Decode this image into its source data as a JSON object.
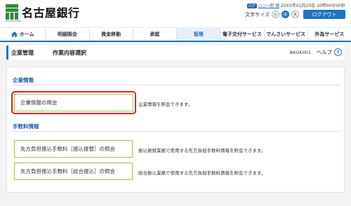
{
  "header": {
    "brand": "名古屋銀行",
    "brand_sub": "NAGOYA BANK",
    "user_badge": "ログ",
    "user_name": "○○一郎 様",
    "login_time": " 20XX年01月20日 10時00分00秒",
    "font_size_label": "文字サイズ",
    "font_sizes": [
      "小",
      "中",
      "大"
    ],
    "logout_label": "ログアウト"
  },
  "nav": {
    "items": [
      {
        "label": "ホーム"
      },
      {
        "label": "明細照会"
      },
      {
        "label": "資金移動"
      },
      {
        "label": "承認"
      },
      {
        "label": "管理"
      },
      {
        "label": "電子交付サービス"
      },
      {
        "label": "でんさいサービス"
      },
      {
        "label": "外為サービス"
      }
    ]
  },
  "titlebar": {
    "title": "企業管理",
    "subtitle": "作業内容選択",
    "screen_id": "BKGK001",
    "help_label": "ヘルプ"
  },
  "sections": [
    {
      "heading": "企業情報",
      "items": [
        {
          "label": "企業情報の照会",
          "description": "企業情報を照会できます。"
        }
      ]
    },
    {
      "heading": "手数料情報",
      "items": [
        {
          "label": "先方負担振込手数料［振込振替］の照会",
          "description": "振込振替業務で使用する先方負担手数料情報を照会できます。"
        },
        {
          "label": "先方負担振込手数料［総合振込］の照会",
          "description": "総合振込業務で使用する先方負担手数料情報を照会できます。"
        }
      ]
    }
  ],
  "colors": {
    "accent": "#1e73be",
    "button_border": "#9cc85a",
    "highlight": "#e02020"
  }
}
